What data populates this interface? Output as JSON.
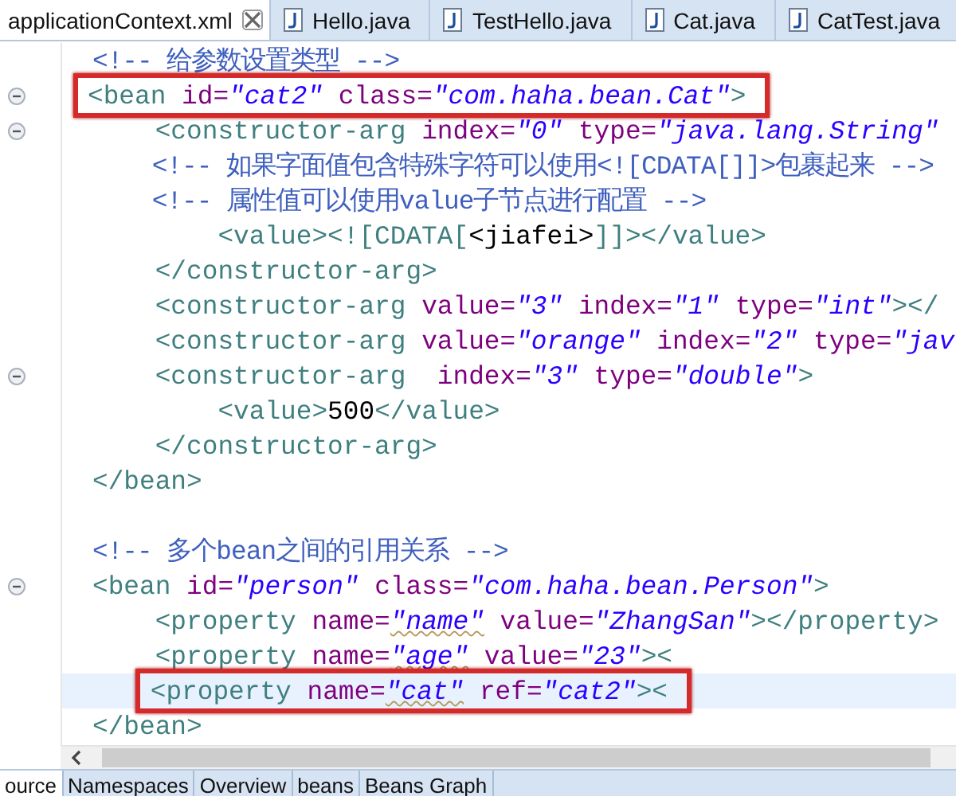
{
  "editor_tabs": [
    {
      "label": "applicationContext.xml",
      "kind": "xml",
      "selected": true
    },
    {
      "label": "Hello.java",
      "kind": "java",
      "selected": false
    },
    {
      "label": "TestHello.java",
      "kind": "java",
      "selected": false
    },
    {
      "label": "Cat.java",
      "kind": "java",
      "selected": false
    },
    {
      "label": "CatTest.java",
      "kind": "java",
      "selected": false
    }
  ],
  "lines": [
    {
      "kind": "code",
      "fold": false,
      "boxed": false,
      "current": false,
      "tokens": [
        {
          "kind": "comment",
          "text": "<!-- 给参数设置类型 -->"
        }
      ]
    },
    {
      "kind": "code",
      "fold": true,
      "boxed": true,
      "current": false,
      "tokens": [
        {
          "kind": "tag",
          "text": "<bean"
        },
        {
          "kind": "attr",
          "text": " id="
        },
        {
          "kind": "value",
          "text": "\"cat2\""
        },
        {
          "kind": "attr",
          "text": " class="
        },
        {
          "kind": "value",
          "text": "\"com.haha.bean.Cat\""
        },
        {
          "kind": "tag",
          "text": ">"
        }
      ]
    },
    {
      "kind": "code",
      "fold": true,
      "boxed": false,
      "current": false,
      "tokens": [
        {
          "kind": "tag",
          "text": "    <constructor-arg"
        },
        {
          "kind": "attr",
          "text": " index="
        },
        {
          "kind": "value",
          "text": "\"0\""
        },
        {
          "kind": "attr",
          "text": " type="
        },
        {
          "kind": "value",
          "text": "\"java.lang.String\""
        }
      ]
    },
    {
      "kind": "code",
      "fold": false,
      "boxed": false,
      "current": false,
      "tokens": [
        {
          "kind": "comment",
          "text": "    <!-- 如果字面值包含特殊字符可以使用<![CDATA[]]>包裹起来 -->"
        }
      ]
    },
    {
      "kind": "code",
      "fold": false,
      "boxed": false,
      "current": false,
      "tokens": [
        {
          "kind": "comment",
          "text": "    <!-- 属性值可以使用value子节点进行配置 -->"
        }
      ]
    },
    {
      "kind": "code",
      "fold": false,
      "boxed": false,
      "current": false,
      "tokens": [
        {
          "kind": "tag",
          "text": "        <value><![CDATA["
        },
        {
          "kind": "text",
          "text": "<jiafei>"
        },
        {
          "kind": "tag",
          "text": "]]></value>"
        }
      ]
    },
    {
      "kind": "code",
      "fold": false,
      "boxed": false,
      "current": false,
      "tokens": [
        {
          "kind": "tag",
          "text": "    </constructor-arg>"
        }
      ]
    },
    {
      "kind": "code",
      "fold": false,
      "boxed": false,
      "current": false,
      "tokens": [
        {
          "kind": "tag",
          "text": "    <constructor-arg"
        },
        {
          "kind": "attr",
          "text": " value="
        },
        {
          "kind": "value",
          "text": "\"3\""
        },
        {
          "kind": "attr",
          "text": " index="
        },
        {
          "kind": "value",
          "text": "\"1\""
        },
        {
          "kind": "attr",
          "text": " type="
        },
        {
          "kind": "value",
          "text": "\"int\""
        },
        {
          "kind": "tag",
          "text": "></"
        }
      ]
    },
    {
      "kind": "code",
      "fold": false,
      "boxed": false,
      "current": false,
      "tokens": [
        {
          "kind": "tag",
          "text": "    <constructor-arg"
        },
        {
          "kind": "attr",
          "text": " value="
        },
        {
          "kind": "value",
          "text": "\"orange\""
        },
        {
          "kind": "attr",
          "text": " index="
        },
        {
          "kind": "value",
          "text": "\"2\""
        },
        {
          "kind": "attr",
          "text": " type="
        },
        {
          "kind": "value",
          "text": "\"jav"
        }
      ]
    },
    {
      "kind": "code",
      "fold": true,
      "boxed": false,
      "current": false,
      "tokens": [
        {
          "kind": "tag",
          "text": "    <constructor-arg"
        },
        {
          "kind": "attr",
          "text": "  index="
        },
        {
          "kind": "value",
          "text": "\"3\""
        },
        {
          "kind": "attr",
          "text": " type="
        },
        {
          "kind": "value",
          "text": "\"double\""
        },
        {
          "kind": "tag",
          "text": ">"
        }
      ]
    },
    {
      "kind": "code",
      "fold": false,
      "boxed": false,
      "current": false,
      "tokens": [
        {
          "kind": "tag",
          "text": "        <value>"
        },
        {
          "kind": "text",
          "text": "500"
        },
        {
          "kind": "tag",
          "text": "</value>"
        }
      ]
    },
    {
      "kind": "code",
      "fold": false,
      "boxed": false,
      "current": false,
      "tokens": [
        {
          "kind": "tag",
          "text": "    </constructor-arg>"
        }
      ]
    },
    {
      "kind": "code",
      "fold": false,
      "boxed": false,
      "current": false,
      "tokens": [
        {
          "kind": "tag",
          "text": "</bean>"
        }
      ]
    },
    {
      "kind": "blank"
    },
    {
      "kind": "code",
      "fold": false,
      "boxed": false,
      "current": false,
      "tokens": [
        {
          "kind": "comment",
          "text": "<!-- 多个bean之间的引用关系 -->"
        }
      ]
    },
    {
      "kind": "code",
      "fold": true,
      "boxed": false,
      "current": false,
      "tokens": [
        {
          "kind": "tag",
          "text": "<bean"
        },
        {
          "kind": "attr",
          "text": " id="
        },
        {
          "kind": "value",
          "text": "\"person\""
        },
        {
          "kind": "attr",
          "text": " class="
        },
        {
          "kind": "value",
          "text": "\"com.haha.bean.Person\""
        },
        {
          "kind": "tag",
          "text": ">"
        }
      ]
    },
    {
      "kind": "code",
      "fold": false,
      "boxed": false,
      "current": false,
      "tokens": [
        {
          "kind": "tag",
          "text": "    <property"
        },
        {
          "kind": "attr",
          "text": " name="
        },
        {
          "kind": "value",
          "text": "\"name\"",
          "misspelled": true
        },
        {
          "kind": "attr",
          "text": " value="
        },
        {
          "kind": "value",
          "text": "\"ZhangSan\""
        },
        {
          "kind": "tag",
          "text": "></property>"
        }
      ]
    },
    {
      "kind": "code",
      "fold": false,
      "boxed": false,
      "current": false,
      "tokens": [
        {
          "kind": "tag",
          "text": "    <property"
        },
        {
          "kind": "attr",
          "text": " name="
        },
        {
          "kind": "value",
          "text": "\"age\"",
          "misspelled": true
        },
        {
          "kind": "attr",
          "text": " value="
        },
        {
          "kind": "value",
          "text": "\"23\""
        },
        {
          "kind": "tag",
          "text": "><"
        }
      ]
    },
    {
      "kind": "code",
      "fold": false,
      "boxed": true,
      "current": true,
      "tokens": [
        {
          "kind": "tag",
          "text": "    <property"
        },
        {
          "kind": "attr",
          "text": " name="
        },
        {
          "kind": "value",
          "text": "\"cat\"",
          "misspelled": true
        },
        {
          "kind": "attr",
          "text": " ref="
        },
        {
          "kind": "value",
          "text": "\"cat2\""
        },
        {
          "kind": "tag",
          "text": "><"
        }
      ]
    },
    {
      "kind": "code",
      "fold": false,
      "boxed": false,
      "current": false,
      "tokens": [
        {
          "kind": "tag",
          "text": "</bean>"
        }
      ]
    }
  ],
  "page_tabs": [
    {
      "label": "ource",
      "selected": true
    },
    {
      "label": "Namespaces",
      "selected": false
    },
    {
      "label": "Overview",
      "selected": false
    },
    {
      "label": "beans",
      "selected": false
    },
    {
      "label": "Beans Graph",
      "selected": false
    }
  ]
}
